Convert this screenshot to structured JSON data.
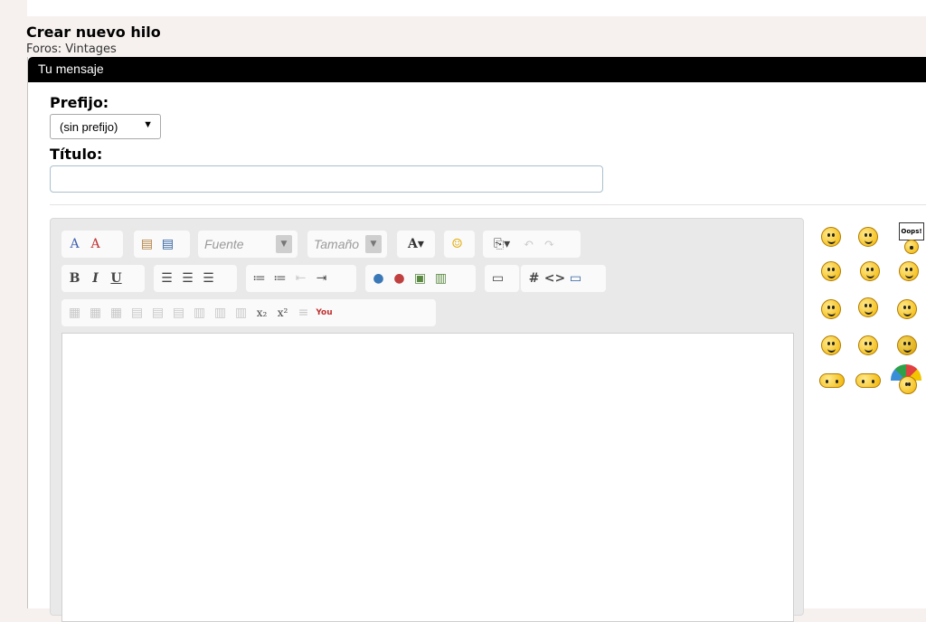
{
  "page": {
    "title": "Crear nuevo hilo",
    "breadcrumb": "Foros: Vintages"
  },
  "panel": {
    "header": "Tu mensaje"
  },
  "form": {
    "prefix_label": "Prefijo:",
    "prefix_value": "(sin prefijo)",
    "title_label": "Título:",
    "title_value": ""
  },
  "toolbar": {
    "font_placeholder": "Fuente",
    "size_placeholder": "Tamaño",
    "buttons": {
      "bold": "B",
      "italic": "I",
      "underline": "U",
      "code_hash": "#",
      "html": "<>",
      "subscript": "x₂",
      "superscript": "x²",
      "font_color": "A▾",
      "youtube": "You"
    }
  },
  "smilies": {
    "sign_text": "Oops!",
    "icons": [
      "smile-icon",
      "wink-icon",
      "oops-icon",
      "laugh-icon",
      "cool-icon",
      "grin-icon",
      "surprised-icon",
      "popcorn-icon",
      "confused-icon",
      "tongue-icon",
      "thinking-icon",
      "sunglasses-icon",
      "sleep-icon",
      "worried-icon",
      "umbrella-icon"
    ]
  },
  "colors": {
    "header_bg": "#000000",
    "page_bg": "#f6f1ef",
    "toolbar_bg": "#e9e9e9"
  }
}
